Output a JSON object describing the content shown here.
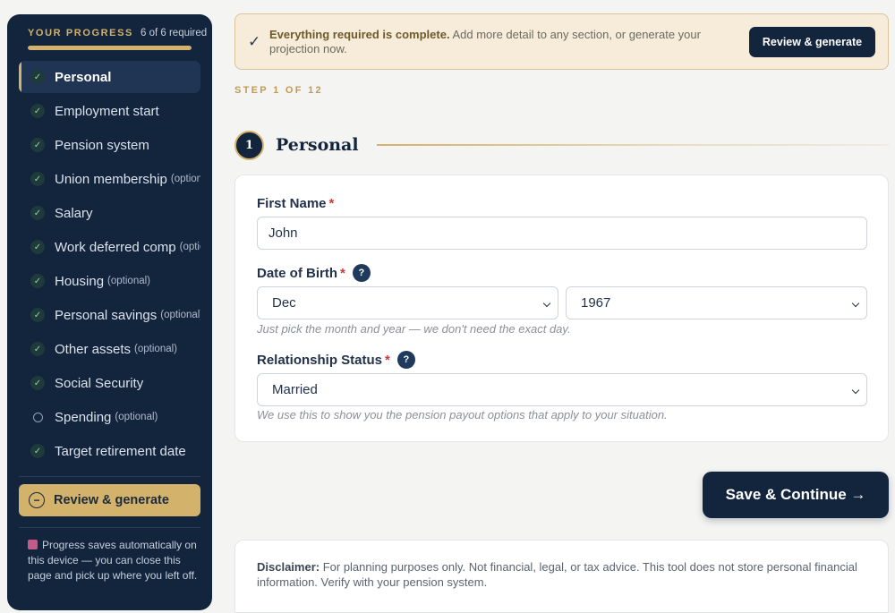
{
  "sidebar": {
    "title": "YOUR PROGRESS",
    "count": "6 of 6 required",
    "progress_fraction": 1.0,
    "items": [
      {
        "label": "Personal",
        "optional": "",
        "status": "done",
        "active": true
      },
      {
        "label": "Employment start",
        "optional": "",
        "status": "done"
      },
      {
        "label": "Pension system",
        "optional": "",
        "status": "done"
      },
      {
        "label": "Union membership",
        "optional": "(optional)",
        "status": "done"
      },
      {
        "label": "Salary",
        "optional": "",
        "status": "done"
      },
      {
        "label": "Work deferred comp",
        "optional": "(optional)",
        "status": "done"
      },
      {
        "label": "Housing",
        "optional": "(optional)",
        "status": "done"
      },
      {
        "label": "Personal savings",
        "optional": "(optional)",
        "status": "done"
      },
      {
        "label": "Other assets",
        "optional": "(optional)",
        "status": "done"
      },
      {
        "label": "Social Security",
        "optional": "",
        "status": "done"
      },
      {
        "label": "Spending",
        "optional": "(optional)",
        "status": "pending"
      },
      {
        "label": "Target retirement date",
        "optional": "",
        "status": "done"
      }
    ],
    "review_label": "Review & generate",
    "save_note": "Progress saves automatically on this device — you can close this page and pick up where you left off."
  },
  "banner": {
    "strong": "Everything required is complete.",
    "text": " Add more detail to any section, or generate your projection now.",
    "button": "Review & generate"
  },
  "step_label": "STEP 1 OF 12",
  "section": {
    "number": "1",
    "title": "Personal"
  },
  "form": {
    "first_name": {
      "label": "First Name",
      "value": "John"
    },
    "dob": {
      "label": "Date of Birth",
      "month": "Dec",
      "year": "1967",
      "hint": "Just pick the month and year — we don't need the exact day."
    },
    "relationship": {
      "label": "Relationship Status",
      "value": "Married",
      "hint": "We use this to show you the pension payout options that apply to your situation."
    },
    "required_mark": "*",
    "help_mark": "?"
  },
  "save_button": "Save & Continue →",
  "disclaimer": {
    "strong": "Disclaimer:",
    "text": " For planning purposes only. Not financial, legal, or tax advice. This tool does not store personal financial information. Verify with your pension system."
  },
  "colors": {
    "navy": "#13243d",
    "gold": "#d3b26b",
    "check_green": "#8fd6a3",
    "required_red": "#cb3b3b"
  }
}
